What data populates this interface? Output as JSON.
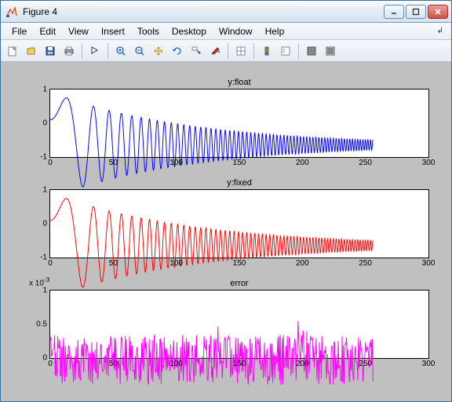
{
  "titlebar": {
    "title": "Figure 4"
  },
  "menu": {
    "items": [
      "File",
      "Edit",
      "View",
      "Insert",
      "Tools",
      "Desktop",
      "Window",
      "Help"
    ]
  },
  "toolbar": {
    "new": "new-file-icon",
    "open": "open-icon",
    "save": "save-icon",
    "print": "print-icon",
    "arrow": "arrow-icon",
    "zoomin": "zoom-in-icon",
    "zoomout": "zoom-out-icon",
    "pan": "pan-icon",
    "rotate": "rotate-icon",
    "datacursor": "data-cursor-icon",
    "brush": "brush-icon",
    "link": "link-icon",
    "colorbar": "colorbar-icon",
    "legend": "legend-icon",
    "hide": "hide-icon",
    "show": "show-icon"
  },
  "chart_data": [
    {
      "type": "line",
      "title": "y:float",
      "xlabel": "",
      "ylabel": "",
      "xlim": [
        0,
        300
      ],
      "ylim": [
        -1,
        1
      ],
      "xticks": [
        0,
        50,
        100,
        150,
        200,
        250,
        300
      ],
      "yticks": [
        -1,
        0,
        1
      ],
      "color": "#0000ff",
      "description": "Chirp signal y=exp(-x/100)*sin(x^2/200), amplitude decaying from 1 to ~0, frequency increasing; data range x∈[0,256]"
    },
    {
      "type": "line",
      "title": "y:fixed",
      "xlabel": "",
      "ylabel": "",
      "xlim": [
        0,
        300
      ],
      "ylim": [
        -1,
        1
      ],
      "xticks": [
        0,
        50,
        100,
        150,
        200,
        250,
        300
      ],
      "yticks": [
        -1,
        0,
        1
      ],
      "color": "#ff0000",
      "description": "Fixed-point version of same chirp signal, visually identical envelope and oscillation; data range x∈[0,256]"
    },
    {
      "type": "line",
      "title": "error",
      "xlabel": "",
      "ylabel": "",
      "xlim": [
        0,
        300
      ],
      "ylim": [
        0,
        0.001
      ],
      "xticks": [
        0,
        50,
        100,
        150,
        200,
        250,
        300
      ],
      "yticks": [
        0,
        0.0005,
        0.001
      ],
      "ytick_labels": [
        "0",
        "0.5",
        "1"
      ],
      "y_exponent": "x 10",
      "y_exp_sup": "-3",
      "color": "#ff00ff",
      "description": "Quantization error, noise-like signal roughly uniform in [0, 5e-4] with peaks to ~8e-4; data range x∈[0,256]"
    }
  ]
}
